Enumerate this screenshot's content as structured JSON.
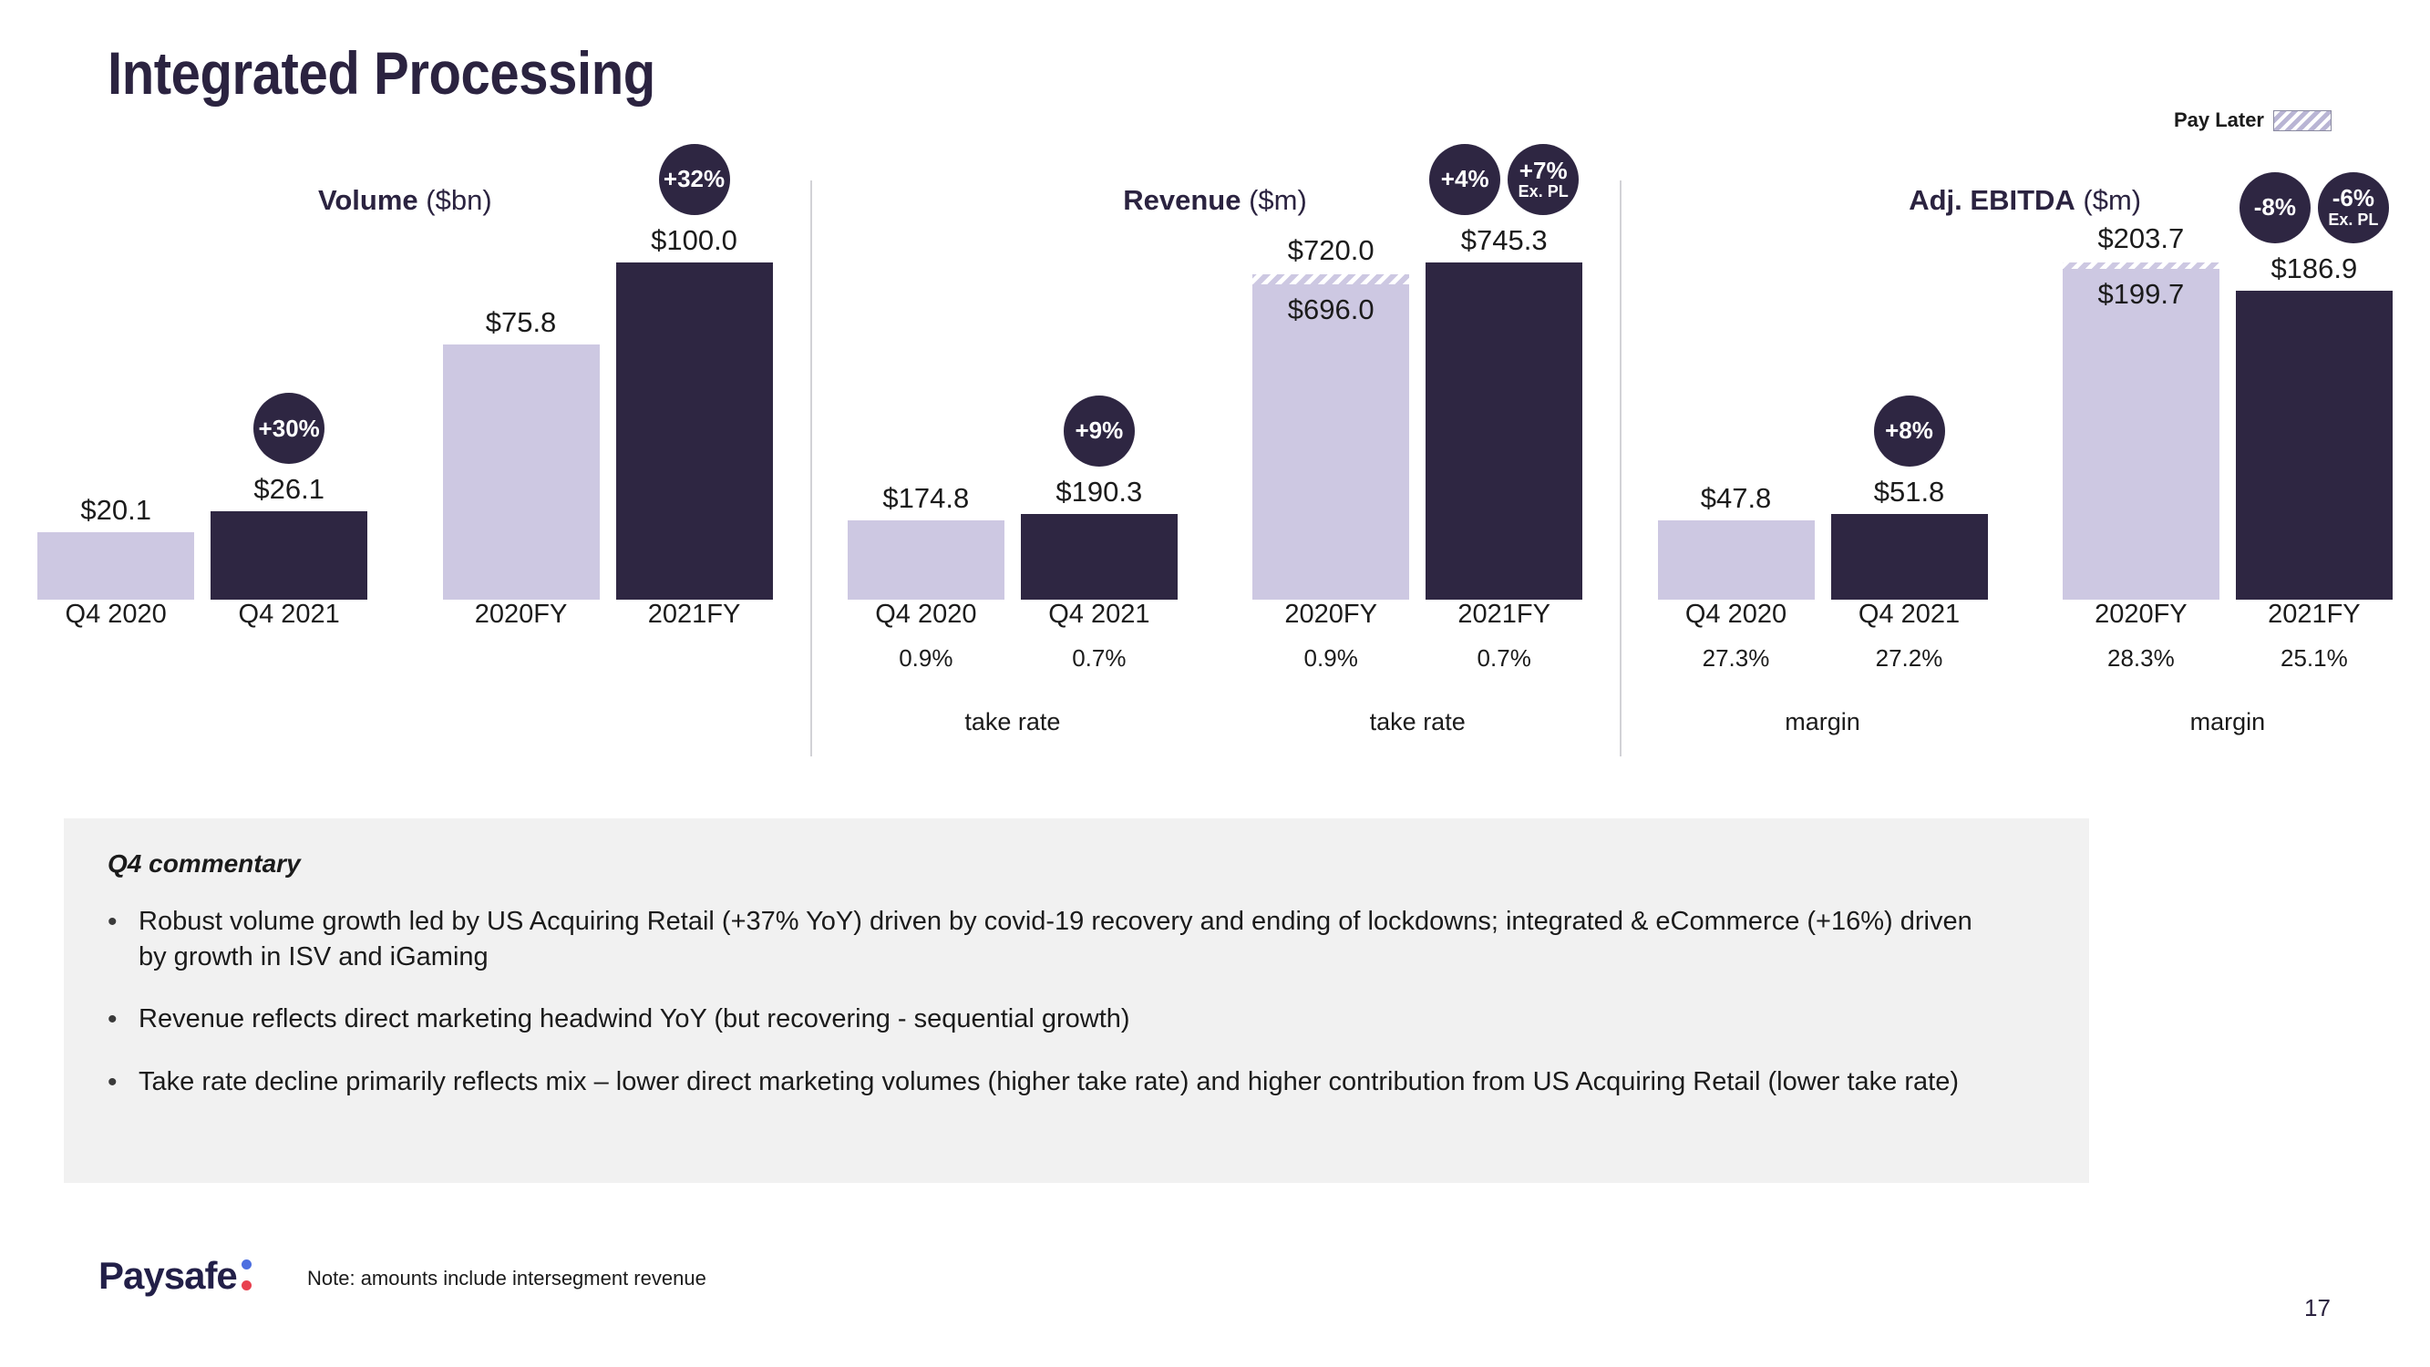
{
  "slide": {
    "title": "Integrated Processing",
    "page_number": "17",
    "note": "Note: amounts include intersegment revenue",
    "logo_word": "Paysafe",
    "colors": {
      "dark": "#2e2642",
      "light": "#cdc8e2",
      "badge": "#2e2642",
      "commentary_bg": "#f1f1f1",
      "logo_dot_top": "#4d6fe0",
      "logo_dot_bottom": "#e8414f"
    }
  },
  "legend": {
    "label": "Pay Later",
    "swatch": "diagonal-hatch"
  },
  "chart_data": [
    {
      "type": "bar",
      "title_bold": "Volume",
      "title_unit": "($bn)",
      "categories": [
        "Q4 2020",
        "Q4 2021",
        "2020FY",
        "2021FY"
      ],
      "values": [
        20.1,
        26.1,
        75.8,
        100.0
      ],
      "labels": [
        "$20.1",
        "$26.1",
        "$75.8",
        "$100.0"
      ],
      "series_styles": [
        "light",
        "dark",
        "light",
        "dark"
      ],
      "pay_later": [
        null,
        null,
        null,
        null
      ],
      "badges": [
        null,
        [
          {
            "main": "+30%",
            "sub": ""
          }
        ],
        null,
        [
          {
            "main": "+32%",
            "sub": ""
          }
        ]
      ],
      "sub_values": [],
      "sub_note": "",
      "ylim": [
        0,
        100.0
      ]
    },
    {
      "type": "bar",
      "title_bold": "Revenue",
      "title_unit": "($m)",
      "categories": [
        "Q4 2020",
        "Q4 2021",
        "2020FY",
        "2021FY"
      ],
      "values": [
        174.8,
        190.3,
        696.0,
        745.3
      ],
      "labels": [
        "$174.8",
        "$190.3",
        "$696.0",
        "$745.3"
      ],
      "totals": [
        null,
        null,
        720.0,
        null
      ],
      "total_labels": [
        null,
        null,
        "$720.0",
        null
      ],
      "series_styles": [
        "light",
        "dark",
        "light",
        "dark"
      ],
      "pay_later": [
        null,
        null,
        24.0,
        null
      ],
      "badges": [
        null,
        [
          {
            "main": "+9%",
            "sub": ""
          }
        ],
        null,
        [
          {
            "main": "+4%",
            "sub": ""
          },
          {
            "main": "+7%",
            "sub": "Ex. PL"
          }
        ]
      ],
      "sub_values": [
        "0.9%",
        "0.7%",
        "0.9%",
        "0.7%"
      ],
      "sub_note": "take rate",
      "ylim": [
        0,
        745.3
      ]
    },
    {
      "type": "bar",
      "title_bold": "Adj. EBITDA",
      "title_unit": "($m)",
      "categories": [
        "Q4 2020",
        "Q4 2021",
        "2020FY",
        "2021FY"
      ],
      "values": [
        47.8,
        51.8,
        199.7,
        186.9
      ],
      "labels": [
        "$47.8",
        "$51.8",
        "$199.7",
        "$186.9"
      ],
      "totals": [
        null,
        null,
        203.7,
        null
      ],
      "total_labels": [
        null,
        null,
        "$203.7",
        null
      ],
      "series_styles": [
        "light",
        "dark",
        "light",
        "dark"
      ],
      "pay_later": [
        null,
        null,
        4.0,
        null
      ],
      "badges": [
        null,
        [
          {
            "main": "+8%",
            "sub": ""
          }
        ],
        null,
        [
          {
            "main": "-8%",
            "sub": ""
          },
          {
            "main": "-6%",
            "sub": "Ex. PL"
          }
        ]
      ],
      "sub_values": [
        "27.3%",
        "27.2%",
        "28.3%",
        "25.1%"
      ],
      "sub_note": "margin",
      "ylim": [
        0,
        203.7
      ]
    }
  ],
  "commentary": {
    "title": "Q4 commentary",
    "bullet_marker": "•",
    "bullets": [
      "Robust volume growth led by US Acquiring Retail (+37% YoY) driven by covid-19 recovery and ending of lockdowns; integrated & eCommerce (+16%) driven by growth in ISV and iGaming",
      "Revenue reflects direct marketing headwind YoY (but recovering - sequential growth)",
      "Take rate decline primarily reflects mix – lower direct marketing volumes (higher take rate) and higher contribution from US Acquiring Retail (lower take rate)"
    ]
  }
}
